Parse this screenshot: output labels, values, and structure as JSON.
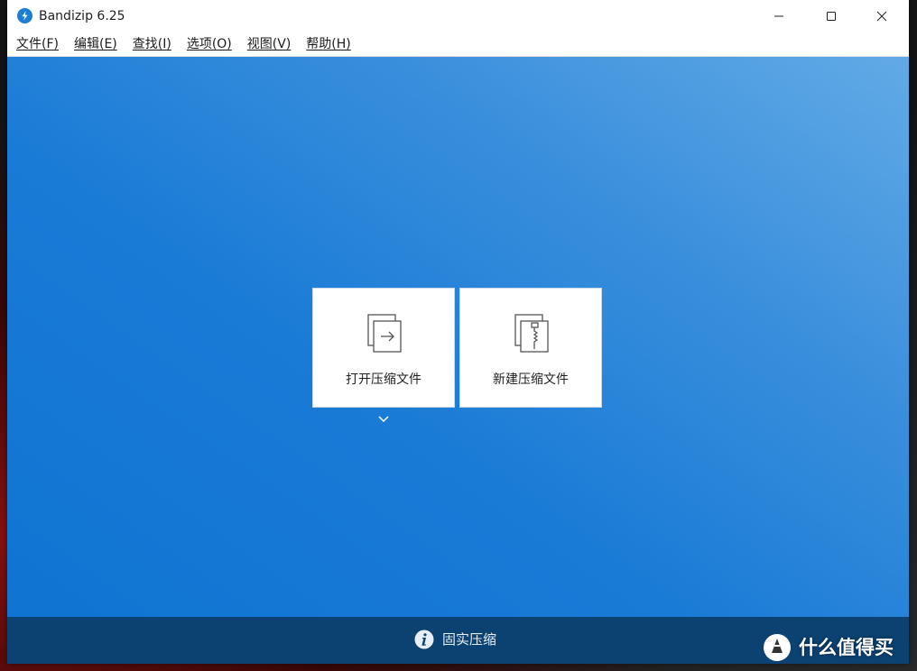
{
  "window": {
    "title": "Bandizip 6.25",
    "minimize_icon": "minimize-icon",
    "maximize_icon": "maximize-icon",
    "close_icon": "close-icon",
    "logo_icon": "bandizip-logo-icon"
  },
  "menu": {
    "items": [
      {
        "label": "文件(F)"
      },
      {
        "label": "编辑(E)"
      },
      {
        "label": "查找(I)"
      },
      {
        "label": "选项(O)"
      },
      {
        "label": "视图(V)"
      },
      {
        "label": "帮助(H)"
      }
    ]
  },
  "main": {
    "open_archive": {
      "label": "打开压缩文件",
      "icon": "open-archive-icon"
    },
    "new_archive": {
      "label": "新建压缩文件",
      "icon": "new-archive-icon"
    },
    "expand_icon": "chevron-down-icon"
  },
  "footer": {
    "label": "固实压缩",
    "icon": "info-icon"
  },
  "watermark": {
    "text": "什么值得买",
    "logo_icon": "smzdm-logo-icon"
  },
  "colors": {
    "main_gradient_light": "#62aae6",
    "main_gradient_dark": "#0f74d2",
    "footer_bar": "#0b4272",
    "logo_blue": "#1a7fd4"
  }
}
